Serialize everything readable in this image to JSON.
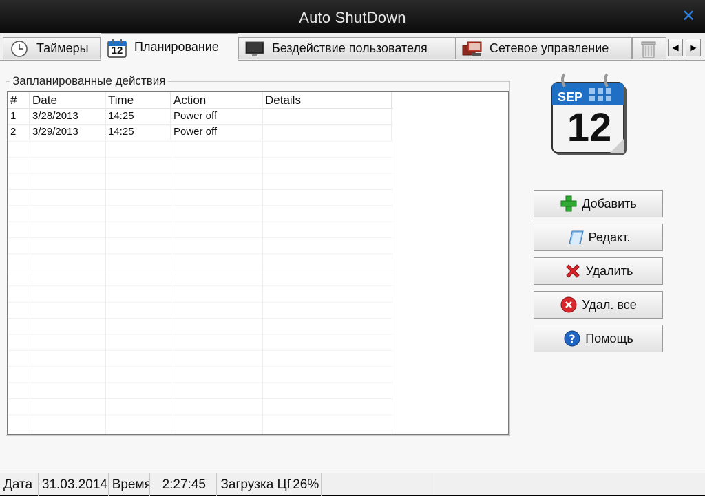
{
  "window": {
    "title": "Auto ShutDown"
  },
  "tabs": [
    {
      "label": "Таймеры",
      "icon": "clock-icon"
    },
    {
      "label": "Планирование",
      "icon": "calendar-icon",
      "icon_text": "12"
    },
    {
      "label": "Бездействие пользователя",
      "icon": "monitor-icon"
    },
    {
      "label": "Сетевое управление",
      "icon": "network-icon"
    },
    {
      "label": "",
      "icon": "trash-icon"
    }
  ],
  "schedule": {
    "group_title": "Запланированные действия",
    "columns": [
      "#",
      "Date",
      "Time",
      "Action",
      "Details"
    ],
    "rows": [
      {
        "num": "1",
        "date": "3/28/2013",
        "time": "14:25",
        "action": "Power off",
        "details": ""
      },
      {
        "num": "2",
        "date": "3/29/2013",
        "time": "14:25",
        "action": "Power off",
        "details": ""
      }
    ]
  },
  "calendar": {
    "month": "SEP",
    "day": "12"
  },
  "buttons": {
    "add": "Добавить",
    "edit": "Редакт.",
    "delete": "Удалить",
    "delete_all": "Удал. все",
    "help": "Помощь"
  },
  "status": {
    "date_label": "Дата",
    "date_value": "31.03.2014",
    "time_label": "Время",
    "time_value": "2:27:45",
    "cpu_label": "Загрузка ЦП",
    "cpu_value": "26%"
  },
  "colors": {
    "accent": "#2d7fe0",
    "calendar_blue": "#1f6fc4",
    "delete_red": "#d8262c",
    "add_green": "#2fa834"
  }
}
